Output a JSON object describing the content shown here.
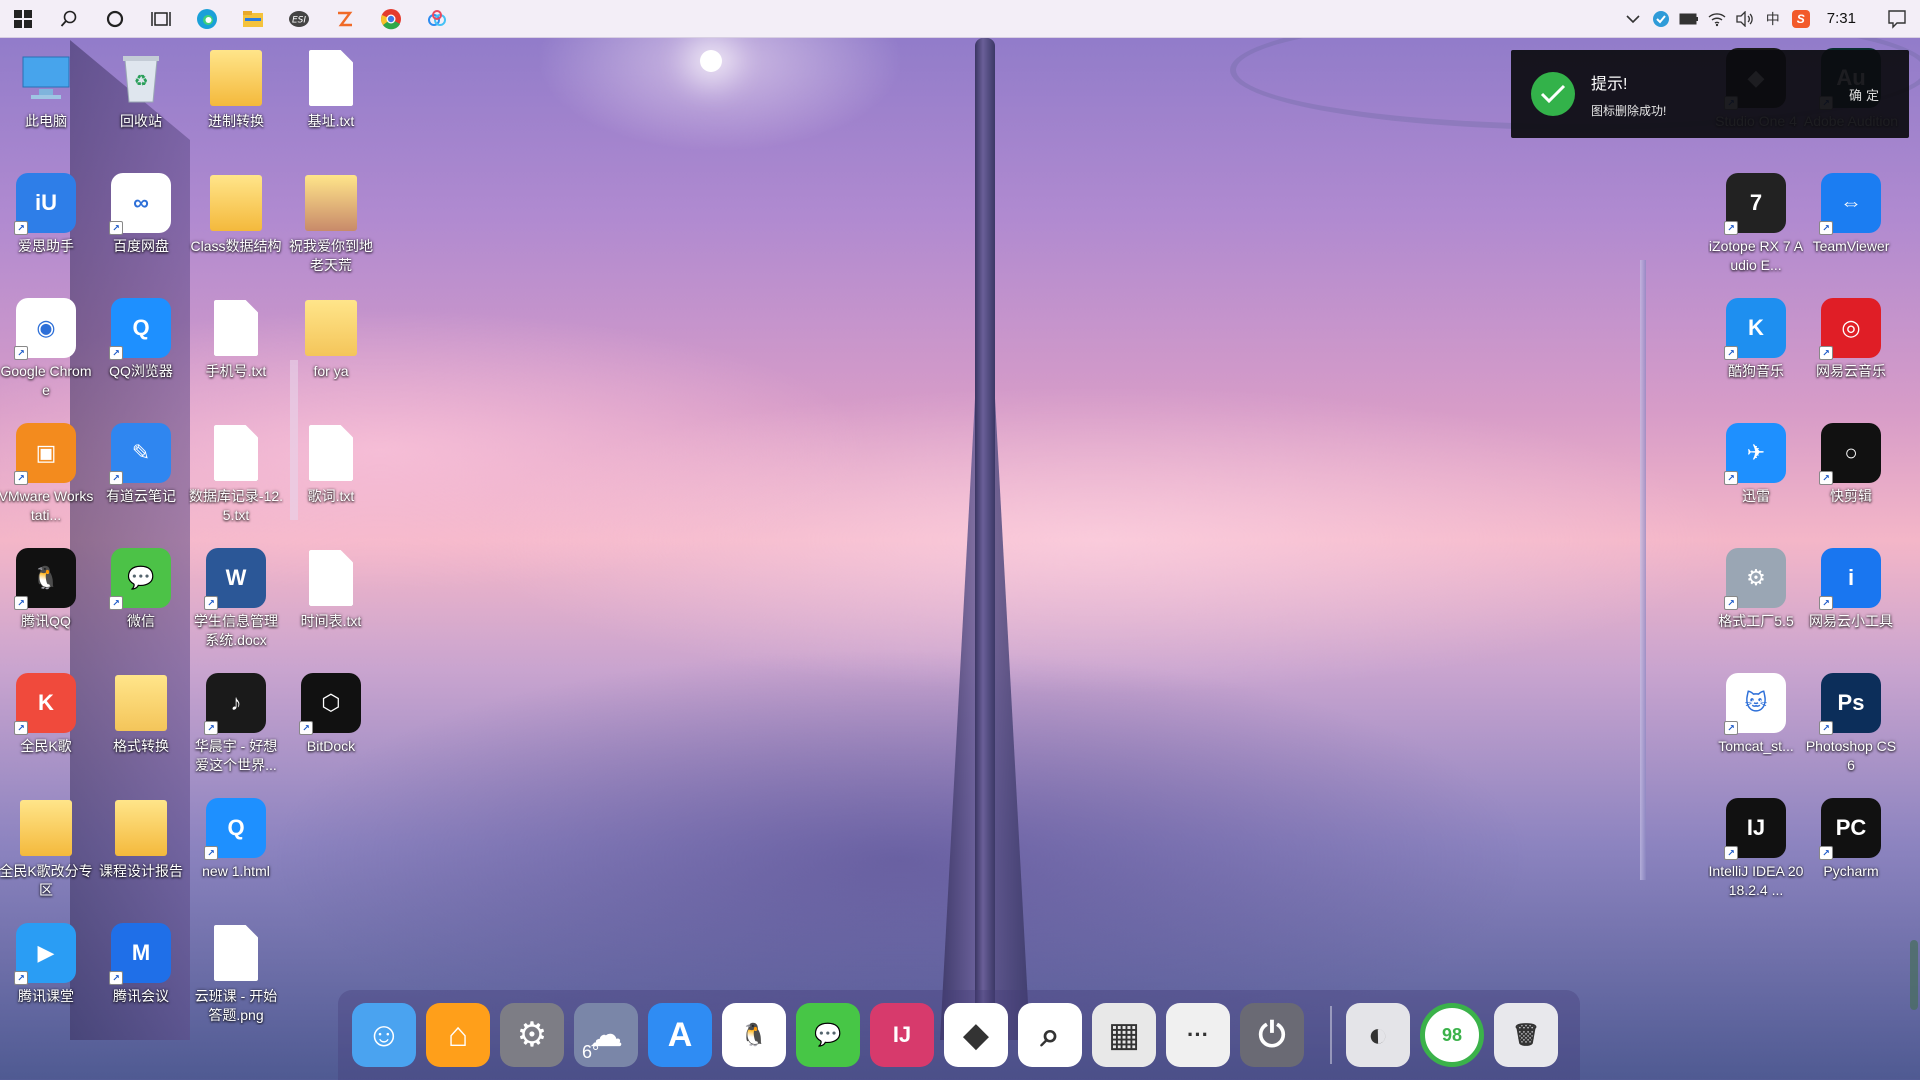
{
  "taskbar": {
    "left_icons": [
      "windows-start-icon",
      "search-icon",
      "cortana-icon",
      "task-view-icon",
      "edge-icon",
      "file-explorer-icon",
      "esi-icon",
      "app-orange-icon",
      "chrome-icon",
      "baidu-netdisk-icon"
    ],
    "tray_icons": [
      "chevron-up-icon",
      "shield-icon",
      "battery-icon",
      "wifi-icon",
      "volume-icon",
      "ime-icon",
      "sogou-icon"
    ],
    "ime_label": "中",
    "sogou_label": "S",
    "time": "7:31"
  },
  "desktop": {
    "icons": [
      {
        "name": "此电脑",
        "type": "pc",
        "color": "#3a8de0"
      },
      {
        "name": "回收站",
        "type": "bin",
        "color": "#cfd6de"
      },
      {
        "name": "进制转换",
        "type": "folder",
        "color": "#f4b93c"
      },
      {
        "name": "基址.txt",
        "type": "file",
        "color": "#ffffff"
      },
      {
        "name": "爱思助手",
        "type": "app",
        "color": "#2e7ee8",
        "glyph": "iU"
      },
      {
        "name": "百度网盘",
        "type": "app",
        "color": "#ffffff",
        "glyph": "∞"
      },
      {
        "name": "Class数据结构",
        "type": "folder",
        "color": "#f4b93c"
      },
      {
        "name": "祝我爱你到地老天荒",
        "type": "folder",
        "color": "#c88a6a"
      },
      {
        "name": "Google Chrome",
        "type": "app",
        "color": "#ffffff",
        "glyph": "◉"
      },
      {
        "name": "QQ浏览器",
        "type": "app",
        "color": "#1e90ff",
        "glyph": "Q"
      },
      {
        "name": "手机号.txt",
        "type": "file",
        "color": "#ffffff"
      },
      {
        "name": "for ya",
        "type": "folder",
        "color": "#f4c55a"
      },
      {
        "name": "VMware Workstati...",
        "type": "app",
        "color": "#f38b1e",
        "glyph": "▣"
      },
      {
        "name": "有道云笔记",
        "type": "app",
        "color": "#2f86f0",
        "glyph": "✎"
      },
      {
        "name": "数据库记录-12.5.txt",
        "type": "file",
        "color": "#ffffff"
      },
      {
        "name": "歌词.txt",
        "type": "file",
        "color": "#ffffff"
      },
      {
        "name": "腾讯QQ",
        "type": "app",
        "color": "#111111",
        "glyph": "🐧"
      },
      {
        "name": "微信",
        "type": "app",
        "color": "#4cc247",
        "glyph": "💬"
      },
      {
        "name": "学生信息管理系统.docx",
        "type": "app",
        "color": "#2b5797",
        "glyph": "W"
      },
      {
        "name": "时间表.txt",
        "type": "file",
        "color": "#ffffff"
      },
      {
        "name": "全民K歌",
        "type": "app",
        "color": "#f04a3c",
        "glyph": "K"
      },
      {
        "name": "格式转换",
        "type": "folder",
        "color": "#f4c55a"
      },
      {
        "name": "华晨宇 - 好想爱这个世界...",
        "type": "app",
        "color": "#1a1a1a",
        "glyph": "♪"
      },
      {
        "name": "BitDock",
        "type": "app",
        "color": "#111111",
        "glyph": "⬡"
      },
      {
        "name": "全民K歌改分专区",
        "type": "folder",
        "color": "#f4b93c"
      },
      {
        "name": "课程设计报告",
        "type": "folder",
        "color": "#f4b93c"
      },
      {
        "name": "new 1.html",
        "type": "app",
        "color": "#1e90ff",
        "glyph": "Q"
      },
      {
        "name": "腾讯课堂",
        "type": "app",
        "color": "#2a9df4",
        "glyph": "▶"
      },
      {
        "name": "腾讯会议",
        "type": "app",
        "color": "#1f6fe8",
        "glyph": "M"
      },
      {
        "name": "云班课 - 开始答题.png",
        "type": "file",
        "color": "#ffffff"
      },
      {
        "name": "Studio One 4",
        "type": "app",
        "color": "#1a1a1a",
        "glyph": "◆"
      },
      {
        "name": "Adobe Audition",
        "type": "app",
        "color": "#0a2e2e",
        "glyph": "Au"
      },
      {
        "name": "iZotope RX 7 Audio E...",
        "type": "app",
        "color": "#222222",
        "glyph": "7"
      },
      {
        "name": "TeamViewer",
        "type": "app",
        "color": "#1b7df2",
        "glyph": "⇔"
      },
      {
        "name": "酷狗音乐",
        "type": "app",
        "color": "#1e8ff0",
        "glyph": "K"
      },
      {
        "name": "网易云音乐",
        "type": "app",
        "color": "#e01e26",
        "glyph": "◎"
      },
      {
        "name": "迅雷",
        "type": "app",
        "color": "#1e90ff",
        "glyph": "✈"
      },
      {
        "name": "快剪辑",
        "type": "app",
        "color": "#111111",
        "glyph": "○"
      },
      {
        "name": "格式工厂5.5",
        "type": "app",
        "color": "#9aa6b4",
        "glyph": "⚙"
      },
      {
        "name": "网易云小工具",
        "type": "app",
        "color": "#1976f0",
        "glyph": "i"
      },
      {
        "name": "Tomcat_st...",
        "type": "app",
        "color": "#ffffff",
        "glyph": "🐱"
      },
      {
        "name": "Photoshop CS6",
        "type": "app",
        "color": "#0c2e5a",
        "glyph": "Ps"
      },
      {
        "name": "IntelliJ IDEA 2018.2.4 ...",
        "type": "app",
        "color": "#111111",
        "glyph": "IJ"
      },
      {
        "name": "Pycharm",
        "type": "app",
        "color": "#111111",
        "glyph": "PC"
      }
    ]
  },
  "toast": {
    "title": "提示!",
    "body": "图标删除成功!",
    "confirm": "确定"
  },
  "dock": {
    "items": [
      {
        "name": "finder-icon",
        "color": "#4aa3f0",
        "glyph": "☺"
      },
      {
        "name": "home-icon",
        "color": "#ff9f1a",
        "glyph": "⌂"
      },
      {
        "name": "settings-icon",
        "color": "#7d7d85",
        "glyph": "⚙"
      },
      {
        "name": "weather-icon",
        "color": "#7a86a8",
        "glyph": "☁"
      },
      {
        "name": "app-store-icon",
        "color": "#2f8cf3",
        "glyph": "A"
      },
      {
        "name": "qq-icon",
        "color": "#ffffff",
        "glyph": "🐧"
      },
      {
        "name": "wechat-icon",
        "color": "#47c646",
        "glyph": "💬"
      },
      {
        "name": "intellij-icon",
        "color": "#d73a6c",
        "glyph": "IJ"
      },
      {
        "name": "studio-one-icon",
        "color": "#ffffff",
        "glyph": "◆"
      },
      {
        "name": "search-icon",
        "color": "#ffffff",
        "glyph": "⌕"
      },
      {
        "name": "calculator-icon",
        "color": "#e8e8e8",
        "glyph": "▦"
      },
      {
        "name": "more-icon",
        "color": "#f0f0f0",
        "glyph": "···"
      },
      {
        "name": "power-icon",
        "color": "#6a6a74",
        "glyph": "⏻"
      }
    ],
    "weather_temp": "6°",
    "right_items": [
      {
        "name": "steam-icon",
        "color": "#e4e4e8",
        "glyph": "◐"
      },
      {
        "name": "cleaner-icon",
        "color": "#ffffff",
        "glyph": "98"
      },
      {
        "name": "trash-icon",
        "color": "#e8e8ec",
        "glyph": "🗑"
      }
    ]
  }
}
